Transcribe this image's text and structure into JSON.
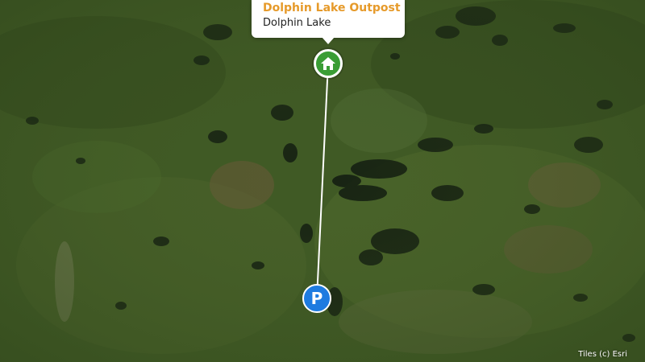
{
  "map": {
    "basemap": "satellite imagery",
    "route_color": "#ffffff"
  },
  "popup": {
    "title": "Dolphin Lake Outpost",
    "title_color": "#e69a2a",
    "subtitle": "Dolphin Lake"
  },
  "markers": {
    "home": {
      "icon": "home-icon",
      "color": "#3a9d35"
    },
    "parking": {
      "icon": "parking-icon",
      "letter": "P",
      "color": "#1e7be0"
    }
  },
  "attribution": "Tiles (c) Esri"
}
